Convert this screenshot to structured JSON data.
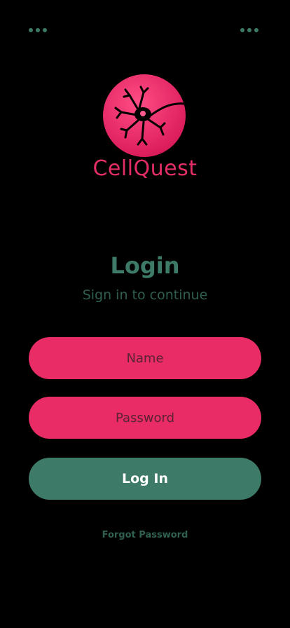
{
  "header": {
    "left_menu_icon": "more-horizontal-icon",
    "right_menu_icon": "more-horizontal-icon"
  },
  "brand": {
    "name": "CellQuest",
    "logo_icon": "neuron-icon"
  },
  "login": {
    "title": "Login",
    "subtitle": "Sign in to continue",
    "name_placeholder": "Name",
    "name_value": "",
    "password_placeholder": "Password",
    "password_value": "",
    "button_label": "Log In",
    "forgot_label": "Forgot Password"
  },
  "colors": {
    "background": "#000000",
    "accent_pink": "#ea2c66",
    "accent_green": "#3e7a68",
    "button_text": "#ffffff"
  }
}
